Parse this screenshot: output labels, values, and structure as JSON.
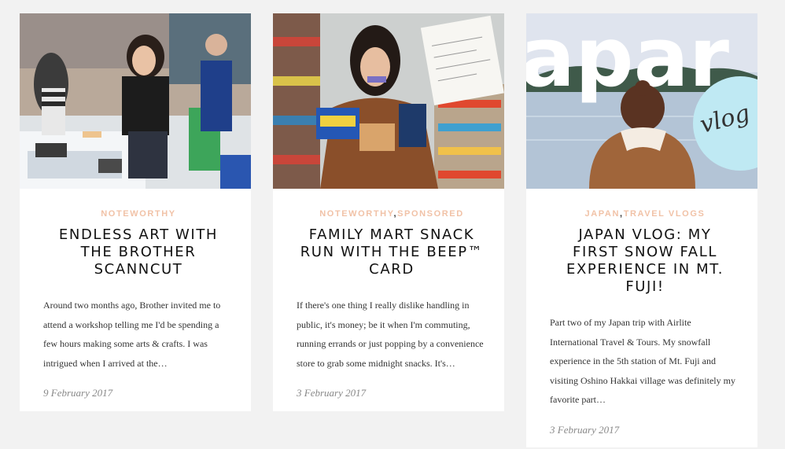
{
  "posts": [
    {
      "categories": [
        "NOTEWORTHY"
      ],
      "title": "ENDLESS ART WITH THE BROTHER SCANNCUT",
      "excerpt": "Around two months ago, Brother invited me to attend a workshop telling me I'd be spending a few hours making some arts & crafts. I was intrigued when I arrived at the…",
      "date": "9 February 2017"
    },
    {
      "categories": [
        "NOTEWORTHY",
        "SPONSORED"
      ],
      "title": "FAMILY MART SNACK RUN WITH THE BEEP™ CARD",
      "excerpt": "If there's one thing I really dislike handling in public, it's money; be it when I'm commuting, running errands or just popping by a convenience store to grab some midnight snacks. It's…",
      "date": "3 February 2017"
    },
    {
      "categories": [
        "JAPAN",
        "TRAVEL VLOGS"
      ],
      "title": "JAPAN VLOG: MY FIRST SNOW FALL EXPERIENCE IN MT. FUJI!",
      "excerpt": "Part two of my Japan trip with Airlite International Travel & Tours. My snowfall experience in the 5th station of Mt. Fuji and visiting Oshino Hakkai village was definitely my favorite part…",
      "date": "3 February 2017",
      "thumbnail_overlay": {
        "big_text": "apar",
        "badge_text": "vlog #"
      }
    }
  ],
  "colors": {
    "background": "#f2f2f2",
    "category": "#f1c2a7",
    "title": "#111111",
    "date": "#888888"
  }
}
